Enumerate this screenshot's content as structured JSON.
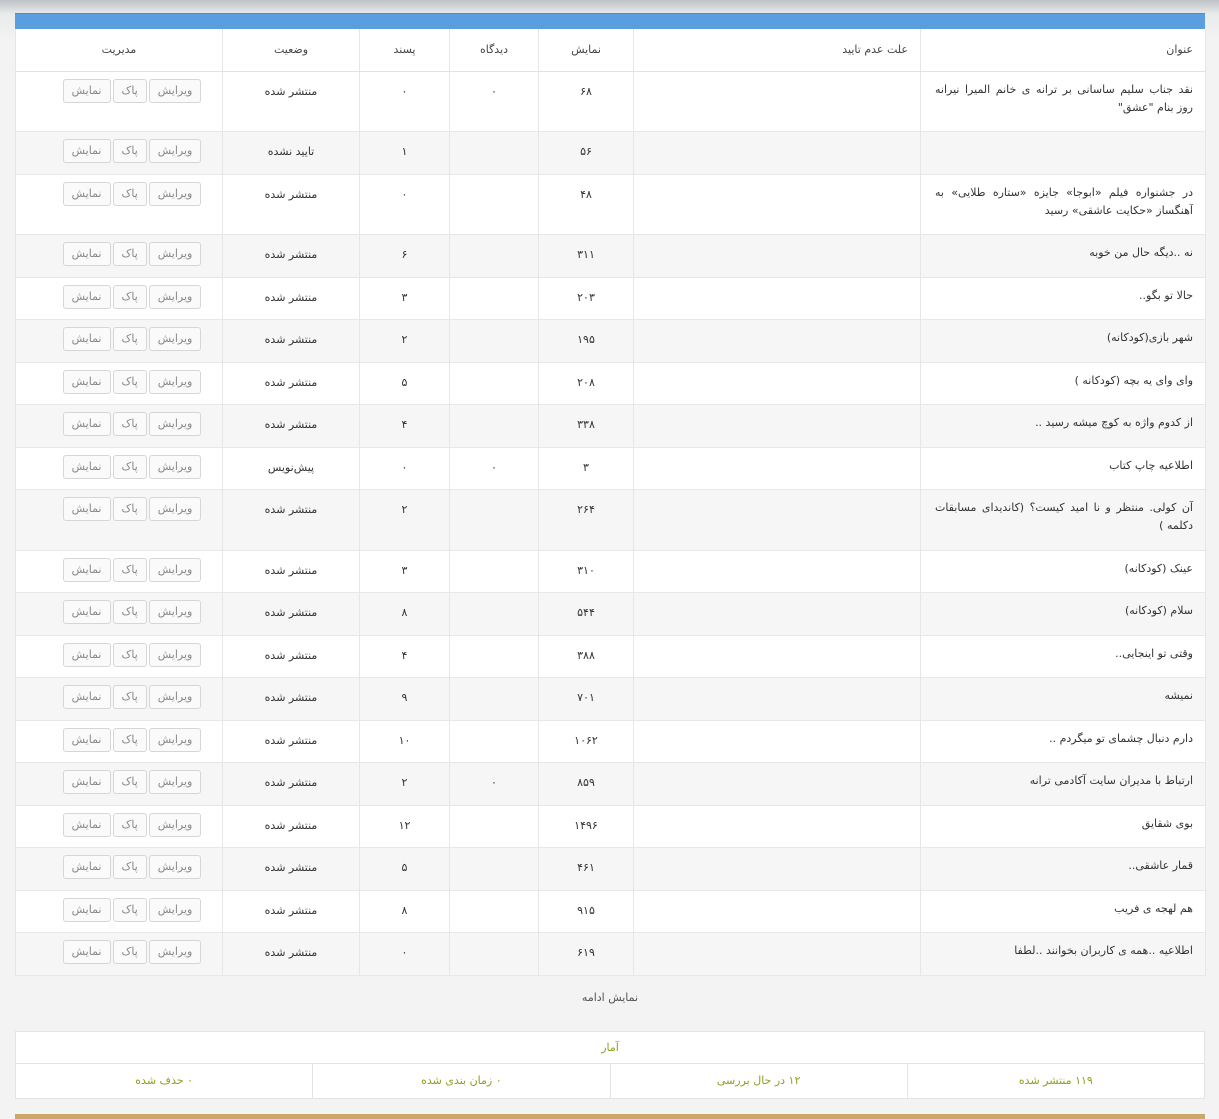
{
  "header": {
    "title": "عنوان",
    "reason": "علت عدم تایید",
    "views": "نمایش",
    "comments": "دیدگاه",
    "likes": "پسند",
    "status": "وضعیت",
    "manage": "مدیریت"
  },
  "actions": {
    "edit": "ویرایش",
    "delete": "پاک",
    "view": "نمایش"
  },
  "rows": [
    {
      "title": "نقد جناب سلیم ساسانی بر ترانه ی خانم المیرا نیرانه روز بنام \"عشق\"",
      "reason": "",
      "views": "۶۸",
      "comments": "۰",
      "likes": "۰",
      "status": "منتشر شده"
    },
    {
      "title": "",
      "reason": "",
      "views": "۵۶",
      "comments": "",
      "likes": "۱",
      "status": "تایید نشده"
    },
    {
      "title": "در جشنواره فیلم «ابوجا» جایزه «ستاره طلایی» به آهنگساز «حکایت عاشقی» رسید",
      "reason": "",
      "views": "۴۸",
      "comments": "",
      "likes": "۰",
      "status": "منتشر شده"
    },
    {
      "title": "نه ..دیگه حال من خوبه",
      "reason": "",
      "views": "۳۱۱",
      "comments": "",
      "likes": "۶",
      "status": "منتشر شده"
    },
    {
      "title": "حالا تو بگو..",
      "reason": "",
      "views": "۲۰۳",
      "comments": "",
      "likes": "۳",
      "status": "منتشر شده"
    },
    {
      "title": "شهر بازی(کودکانه)",
      "reason": "",
      "views": "۱۹۵",
      "comments": "",
      "likes": "۲",
      "status": "منتشر شده"
    },
    {
      "title": "وای وای یه بچه (کودکانه )",
      "reason": "",
      "views": "۲۰۸",
      "comments": "",
      "likes": "۵",
      "status": "منتشر شده"
    },
    {
      "title": "از کدوم واژه به کوچ میشه رسید ..",
      "reason": "",
      "views": "۳۳۸",
      "comments": "",
      "likes": "۴",
      "status": "منتشر شده"
    },
    {
      "title": "اطلاعیه چاپ کتاب",
      "reason": "",
      "views": "۳",
      "comments": "۰",
      "likes": "۰",
      "status": "پیش‌نویس"
    },
    {
      "title": "آن کولی. منتظر و نا امید کیست؟ (کاندیدای مسابقات دکلمه )",
      "reason": "",
      "views": "۲۶۴",
      "comments": "",
      "likes": "۲",
      "status": "منتشر شده"
    },
    {
      "title": "عینک (کودکانه)",
      "reason": "",
      "views": "۳۱۰",
      "comments": "",
      "likes": "۳",
      "status": "منتشر شده"
    },
    {
      "title": "سلام (کودکانه)",
      "reason": "",
      "views": "۵۴۴",
      "comments": "",
      "likes": "۸",
      "status": "منتشر شده"
    },
    {
      "title": "وقتی تو اینجایی..",
      "reason": "",
      "views": "۳۸۸",
      "comments": "",
      "likes": "۴",
      "status": "منتشر شده"
    },
    {
      "title": "نمیشه",
      "reason": "",
      "views": "۷۰۱",
      "comments": "",
      "likes": "۹",
      "status": "منتشر شده"
    },
    {
      "title": "دارم دنبال چشمای تو میگردم ..",
      "reason": "",
      "views": "۱۰۶۲",
      "comments": "",
      "likes": "۱۰",
      "status": "منتشر شده"
    },
    {
      "title": "ارتباط با مدیران سایت آکادمی ترانه",
      "reason": "",
      "views": "۸۵۹",
      "comments": "۰",
      "likes": "۲",
      "status": "منتشر شده"
    },
    {
      "title": "بوی شقایق",
      "reason": "",
      "views": "۱۴۹۶",
      "comments": "",
      "likes": "۱۲",
      "status": "منتشر شده"
    },
    {
      "title": "قمار عاشقی..",
      "reason": "",
      "views": "۴۶۱",
      "comments": "",
      "likes": "۵",
      "status": "منتشر شده"
    },
    {
      "title": "هم لهجه ی فریب",
      "reason": "",
      "views": "۹۱۵",
      "comments": "",
      "likes": "۸",
      "status": "منتشر شده"
    },
    {
      "title": "اطلاعیه ..همه ی کاربران بخوانند ..لطفا",
      "reason": "",
      "views": "۶۱۹",
      "comments": "",
      "likes": "۰",
      "status": "منتشر شده"
    }
  ],
  "more_label": "نمایش ادامه",
  "stats": {
    "title": "آمار",
    "published": "۱۱۹ منتشر شده",
    "pending": "۱۲ در حال بررسی",
    "scheduled": "۰ زمان بندی شده",
    "deleted": "۰ حذف شده"
  },
  "colors": {
    "header_bar": "#5a9ee0",
    "stats_text": "#8aa11e",
    "bottom_bar": "#c9a86a"
  }
}
